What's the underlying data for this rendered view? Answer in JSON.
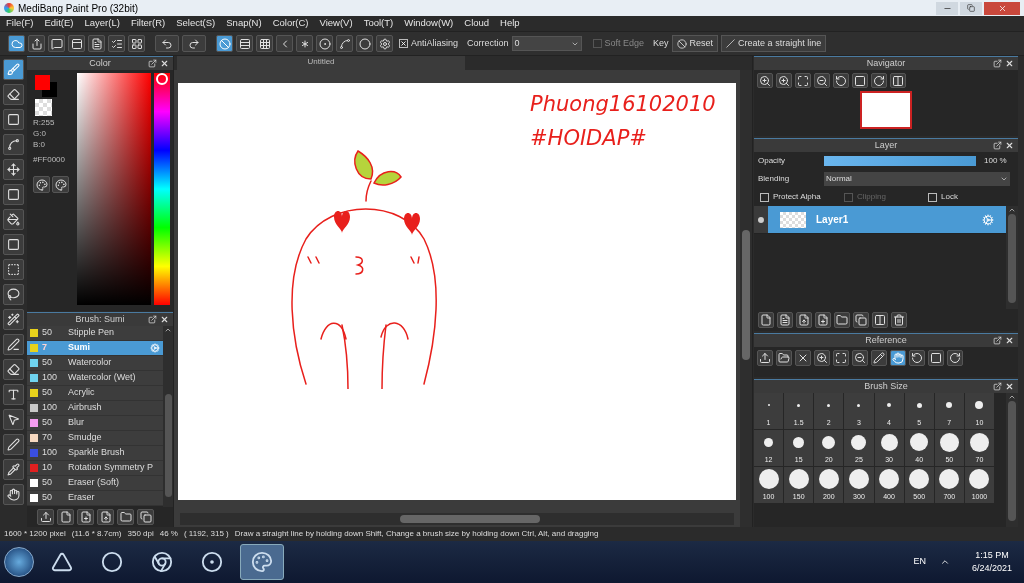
{
  "window": {
    "title": "MediBang Paint Pro (32bit)"
  },
  "menu": [
    "File(F)",
    "Edit(E)",
    "Layer(L)",
    "Filter(R)",
    "Select(S)",
    "Snap(N)",
    "Color(C)",
    "View(V)",
    "Tool(T)",
    "Window(W)",
    "Cloud",
    "Help"
  ],
  "toolbar": {
    "snap_tools": [
      {
        "selected": true
      },
      {
        "selected": false
      },
      {
        "selected": false
      },
      {
        "selected": false
      },
      {
        "selected": false
      },
      {
        "selected": false
      },
      {
        "selected": false
      },
      {
        "selected": false
      }
    ],
    "antialiasing": {
      "label": "AntiAliasing",
      "checked": true
    },
    "correction": {
      "label": "Correction",
      "value": "0"
    },
    "soft_edge": {
      "label": "Soft Edge",
      "checked": false,
      "disabled": true
    },
    "key_label": "Key",
    "reset": "Reset",
    "straight_line": "Create a straight line"
  },
  "tools": [
    {
      "selected": true
    },
    {
      "selected": false
    },
    {
      "selected": false
    },
    {
      "selected": false
    },
    {
      "selected": false
    },
    {
      "selected": false
    },
    {
      "selected": false
    },
    {
      "selected": false
    },
    {
      "selected": false
    },
    {
      "selected": false
    },
    {
      "selected": false
    },
    {
      "selected": false
    },
    {
      "selected": false
    },
    {
      "selected": false
    },
    {
      "selected": false
    },
    {
      "selected": false
    },
    {
      "selected": false
    },
    {
      "selected": false
    }
  ],
  "color_panel": {
    "title": "Color",
    "hue": {
      "level": 0
    },
    "r": "R:255",
    "g": "G:0",
    "b": "B:0",
    "hex": "#FF0000"
  },
  "brush_panel": {
    "title": "Brush: Sumi",
    "items": [
      {
        "size": "50",
        "name": "Stipple Pen",
        "color": "#e8d21c",
        "selected": false
      },
      {
        "size": "7",
        "name": "Sumi",
        "color": "#e8d21c",
        "selected": true
      },
      {
        "size": "50",
        "name": "Watercolor",
        "color": "#6fd3ef",
        "selected": false
      },
      {
        "size": "100",
        "name": "Watercolor (Wet)",
        "color": "#6fd3ef",
        "selected": false
      },
      {
        "size": "50",
        "name": "Acrylic",
        "color": "#e8d21c",
        "selected": false
      },
      {
        "size": "100",
        "name": "Airbrush",
        "color": "#c8c8c8",
        "selected": false
      },
      {
        "size": "50",
        "name": "Blur",
        "color": "#f49cf0",
        "selected": false
      },
      {
        "size": "70",
        "name": "Smudge",
        "color": "#f6d8c0",
        "selected": false
      },
      {
        "size": "100",
        "name": "Sparkle Brush",
        "color": "#3a4ee0",
        "selected": false
      },
      {
        "size": "10",
        "name": "Rotation Symmetry P",
        "color": "#e02020",
        "selected": false
      },
      {
        "size": "50",
        "name": "Eraser (Soft)",
        "color": "#ffffff",
        "selected": false
      },
      {
        "size": "50",
        "name": "Eraser",
        "color": "#ffffff",
        "selected": false
      }
    ]
  },
  "canvas": {
    "tab": "Untitled",
    "writing": [
      "Phuong16102010",
      "#HOIDAP#"
    ]
  },
  "navigator": {
    "title": "Navigator"
  },
  "layer_panel": {
    "title": "Layer",
    "opacity_label": "Opacity",
    "level": 1.0,
    "reading": "100 %",
    "blending_label": "Blending",
    "blending": "Normal",
    "options": [
      {
        "label": "Protect Alpha",
        "checked": false,
        "disabled": false
      },
      {
        "label": "Clipping",
        "checked": false,
        "disabled": true
      },
      {
        "label": "Lock",
        "checked": false,
        "disabled": false
      }
    ],
    "layers": [
      {
        "name": "Layer1",
        "selected": true,
        "visible": true
      }
    ]
  },
  "reference": {
    "title": "Reference",
    "tools": [
      {
        "selected": false
      },
      {
        "selected": false
      },
      {
        "selected": false
      },
      {
        "selected": false
      },
      {
        "selected": false
      },
      {
        "selected": false
      },
      {
        "selected": false
      },
      {
        "selected": true
      },
      {
        "selected": false
      },
      {
        "selected": false
      },
      {
        "selected": false
      }
    ]
  },
  "brush_size": {
    "title": "Brush Size",
    "sizes": [
      "1",
      "1.5",
      "2",
      "3",
      "4",
      "5",
      "7",
      "10",
      "12",
      "15",
      "20",
      "25",
      "30",
      "40",
      "50",
      "70",
      "100",
      "150",
      "200",
      "300",
      "400",
      "500",
      "700",
      "1000"
    ]
  },
  "status_bar": [
    "1600 * 1200 pixel",
    "(11.6 * 8.7cm)",
    "350 dpi",
    "46 %",
    "( 1192, 315 )",
    "Draw a straight line by holding down Shift, Change a brush size by holding down Ctrl, Alt, and dragging"
  ],
  "taskbar": {
    "apps": [
      {
        "selected": false
      },
      {
        "selected": false
      },
      {
        "selected": false
      },
      {
        "selected": false
      },
      {
        "selected": true
      }
    ],
    "language": "EN",
    "time": "1:15 PM",
    "date": "6/24/2021"
  }
}
